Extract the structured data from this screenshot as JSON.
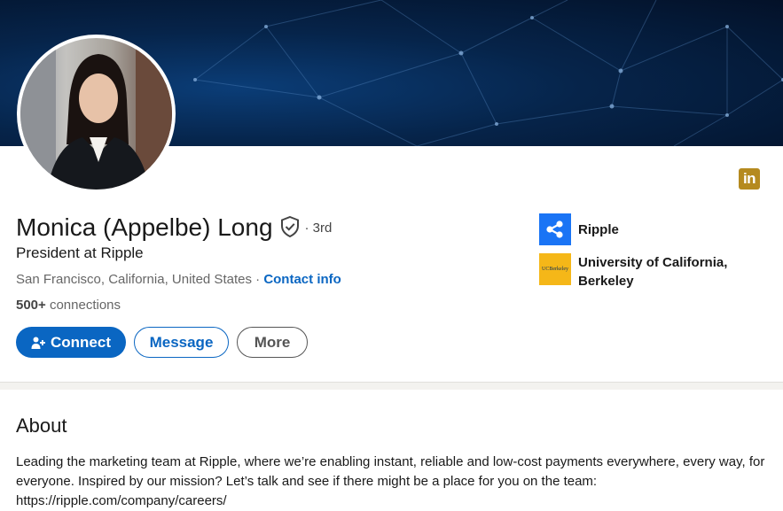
{
  "profile": {
    "name": "Monica (Appelbe) Long",
    "degree": "· 3rd",
    "headline": "President at Ripple",
    "location": "San Francisco, California, United States",
    "location_sep": " · ",
    "contact_label": "Contact info",
    "connections_count": "500+",
    "connections_label": " connections"
  },
  "actions": {
    "connect_label": "Connect",
    "message_label": "Message",
    "more_label": "More"
  },
  "orgs": {
    "company": "Ripple",
    "school": "University of California, Berkeley",
    "school_logo_text": "UCBerkeley"
  },
  "badge": {
    "text": "in"
  },
  "about": {
    "title": "About",
    "text": "Leading the marketing team at Ripple, where we’re enabling instant, reliable and low-cost payments everywhere, every way, for everyone. Inspired by our mission? Let’s talk and see if there might be a place for you on the team: https://ripple.com/company/careers/"
  },
  "colors": {
    "brand_blue": "#0a66c2",
    "ripple_blue": "#1a74f5",
    "berkeley_gold": "#f5b718",
    "linkedin_badge": "#b58a1f"
  },
  "icons": {
    "verified": "shield-check-icon",
    "connect": "person-plus-icon",
    "company_logo": "ripple-logo-icon",
    "school_logo": "berkeley-logo-icon",
    "social": "linkedin-icon"
  }
}
